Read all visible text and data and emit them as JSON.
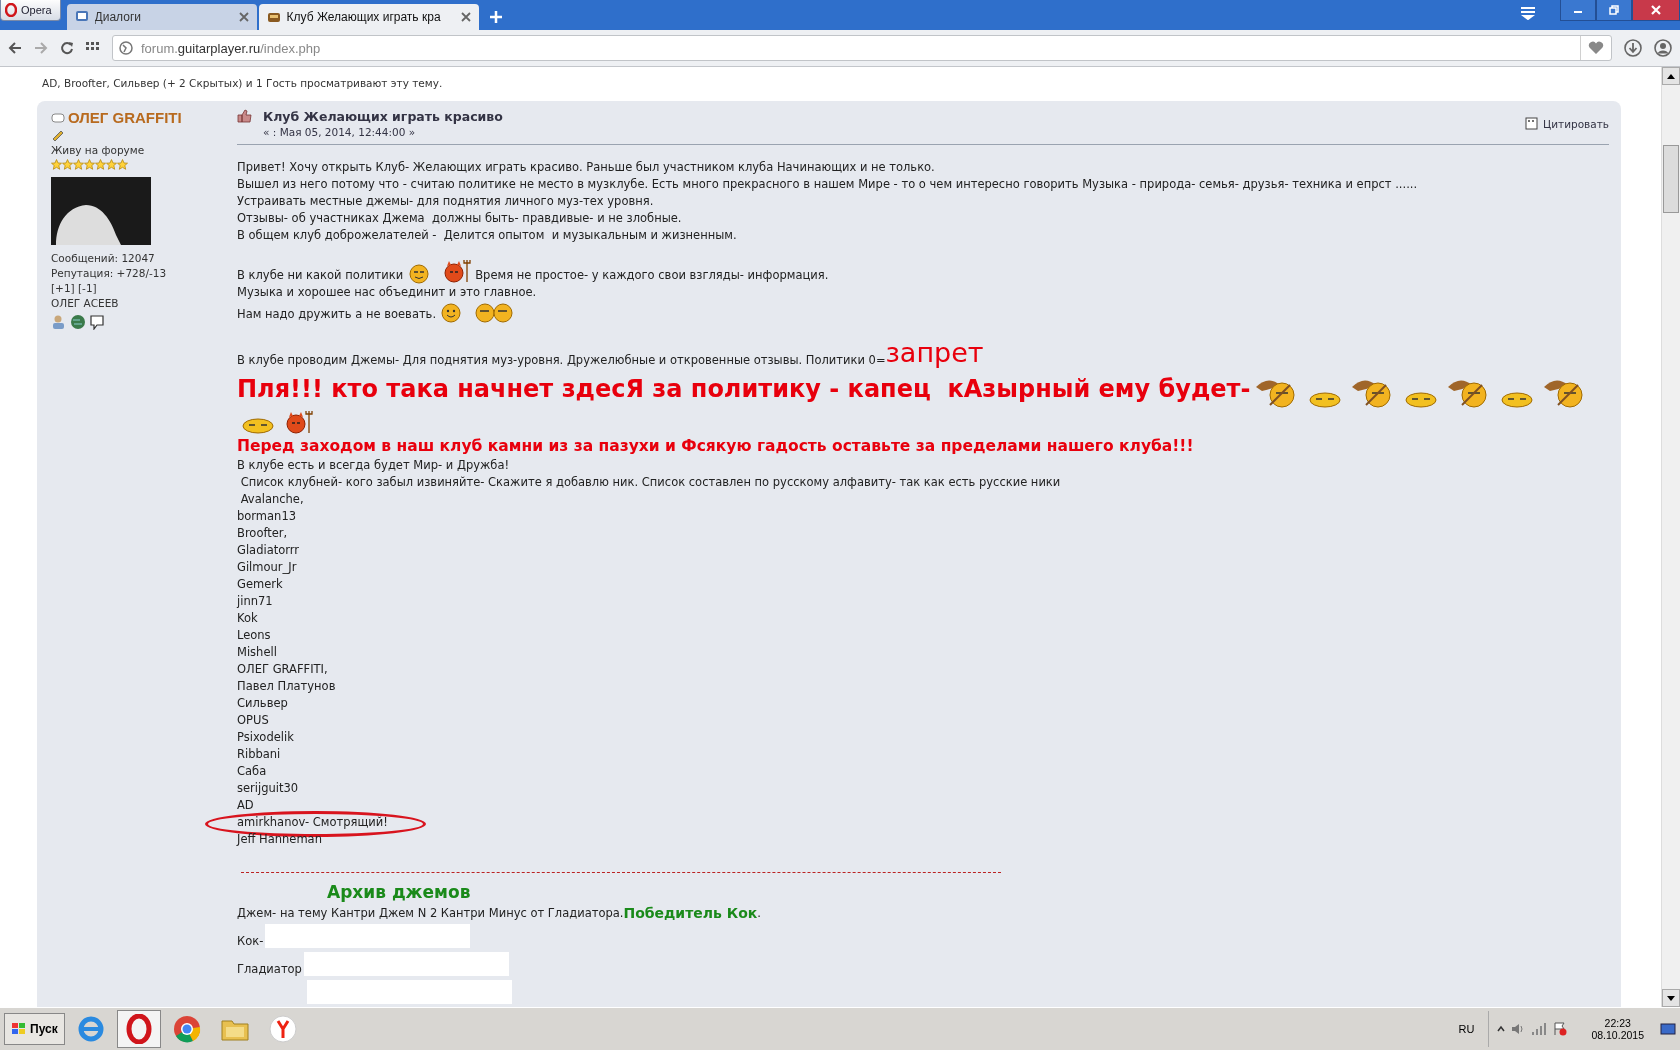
{
  "browser": {
    "menu_label": "Opera",
    "tabs": [
      {
        "label": "Диалоги",
        "selected": false
      },
      {
        "label": "Клуб Желающих играть кра",
        "selected": true
      }
    ],
    "address": {
      "prefix": "forum.",
      "domain": "guitarplayer.ru",
      "path": "/index.php"
    }
  },
  "viewers": "AD, Broofter, Сильвер (+ 2 Скрытых) и 1 Гость просматривают эту тему.",
  "post": {
    "author": {
      "name": "ОЛЕГ GRAFFITI",
      "online": false,
      "rank": "Живу на форуме",
      "stars": 7,
      "posts": "Сообщений: 12047",
      "reputation": "Репутация: +728/-13",
      "votes": "[+1] [-1]",
      "real_name": "ОЛЕГ АСЕЕВ"
    },
    "title": "Клуб Желающих играть красиво",
    "date": "« : Мая 05, 2014, 12:44:00 »",
    "quote_button": "Цитировать",
    "lines": [
      {
        "text": "Привет! Хочу открыть Клуб- Желающих играть красиво. Раньше был участником клуба Начинающих и не только."
      },
      {
        "text": "Вышел из него потому что - считаю политике не место в музклубе. Есть много прекрасного в нашем Мире - то о чем интересно говорить Музыка - природа- семья- друзья- техника и епрст ......"
      },
      {
        "text": "Устраивать местные джемы- для поднятия личного муз-тех уровня."
      },
      {
        "text": "Отзывы- об участниках Джема  должны быть- правдивые- и не злобные."
      },
      {
        "text": "В общем клуб доброжелателей -  Делится опытом  и музыкальным и жизненным."
      },
      {
        "kind": "gap"
      },
      {
        "segments": [
          {
            "kind": "text",
            "text": "В клубе ни какой политики"
          },
          {
            "kind": "grin"
          },
          {
            "kind": "devil"
          },
          {
            "kind": "text",
            "text": "Время не простое- у каждого свои взгляды- информация."
          }
        ]
      },
      {
        "text": "Музыка и хорошее нас объединит и это главное."
      },
      {
        "segments": [
          {
            "kind": "text",
            "text": "Нам надо дружить а не воевать."
          },
          {
            "kind": "smile"
          },
          {
            "kind": "twins"
          }
        ]
      },
      {
        "kind": "gap"
      },
      {
        "segments": [
          {
            "kind": "text",
            "text": "В клубе проводим Джемы- Для поднятия муз-уровня. Дружелюбные и откровенные отзывы. Политики 0="
          },
          {
            "kind": "red_large",
            "text": "запрет"
          }
        ]
      },
      {
        "segments": [
          {
            "kind": "red_huge",
            "text": "Пля!!! кто така начнет здесЯ за политику - капец  кАзырный ему будет-"
          },
          {
            "kind": "bee"
          },
          {
            "kind": "sleepy"
          },
          {
            "kind": "bee"
          },
          {
            "kind": "sleepy"
          },
          {
            "kind": "bee"
          },
          {
            "kind": "sleepy"
          },
          {
            "kind": "bee"
          },
          {
            "kind": "sleepy"
          },
          {
            "kind": "devil"
          }
        ]
      },
      {
        "segments": [
          {
            "kind": "red_bold",
            "text": "Перед заходом в наш клуб камни из за пазухи и Фсякую гадость оставьте за пределами нашего клуба!!!"
          }
        ]
      },
      {
        "text": "В клубе есть и всегда будет Мир- и Дружба!"
      },
      {
        "text": " Список клубней- кого забыл извиняйте- Скажите я добавлю ник. Список составлен по русскому алфавиту- так как есть русские ники"
      },
      {
        "text": " Avalanche,"
      },
      {
        "text": "borman13"
      },
      {
        "text": "Broofter,"
      },
      {
        "text": "Gladiatorrr"
      },
      {
        "text": "Gilmour_Jr"
      },
      {
        "text": "Gemerk"
      },
      {
        "text": "jinn71"
      },
      {
        "text": "Kok"
      },
      {
        "text": "Leons"
      },
      {
        "text": "Mishell"
      },
      {
        "text": "ОЛЕГ GRAFFITI,"
      },
      {
        "text": "Павел Платунов"
      },
      {
        "text": "Сильвер"
      },
      {
        "text": "OPUS"
      },
      {
        "text": "Psixodelik"
      },
      {
        "text": "Ribbani"
      },
      {
        "text": "Саба"
      },
      {
        "text": "serijguit30"
      },
      {
        "text": "AD"
      },
      {
        "text": "amirkhanov- Смотрящий!",
        "circled": true
      },
      {
        "text": "Jeff Hanneman"
      },
      {
        "kind": "rule"
      },
      {
        "segments": [
          {
            "kind": "green_heading",
            "text": "Архив джемов"
          }
        ]
      },
      {
        "segments": [
          {
            "kind": "text",
            "text": "Джем- на тему Кантри Джем N 2 Кантри Минус от Гладиатора."
          },
          {
            "kind": "green_bold",
            "text": "Победитель Кок"
          },
          {
            "kind": "text",
            "text": "."
          }
        ]
      },
      {
        "segments": [
          {
            "kind": "text",
            "text": "Кок-"
          },
          {
            "kind": "embed"
          }
        ]
      },
      {
        "segments": [
          {
            "kind": "text",
            "text": "Гладиатор"
          },
          {
            "kind": "embed"
          }
        ]
      },
      {
        "segments": [
          {
            "kind": "embed_offset"
          }
        ]
      }
    ]
  },
  "taskbar": {
    "start": "Пуск",
    "language": "RU",
    "time": "22:23",
    "date": "08.10.2015"
  }
}
